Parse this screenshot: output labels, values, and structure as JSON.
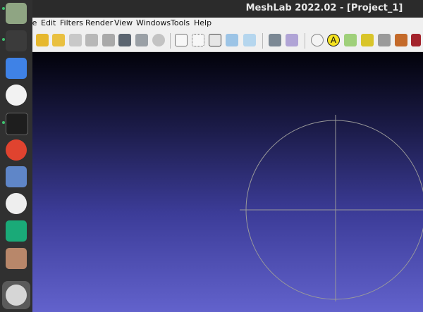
{
  "window": {
    "title": "MeshLab 2022.02 - [Project_1]"
  },
  "menu": {
    "file": "File",
    "edit": "Edit",
    "filters": "Filters",
    "render": "Render",
    "view": "View",
    "windows": "Windows",
    "tools": "Tools",
    "help": "Help"
  },
  "toolbar": {
    "icons": [
      "new-project-icon",
      "open-project-icon",
      "open-mesh-icon",
      "reload-icon",
      "reload-all-icon",
      "save-snapshot-icon",
      "camera-icon",
      "layer-stack-icon",
      "globe-render-icon",
      "bbox-icon",
      "points-icon",
      "wireframe-icon",
      "flat-shading-icon",
      "smooth-shading-icon",
      "layers-icon",
      "axes-icon",
      "trackball-icon",
      "text-annotation-icon",
      "move-axes-icon",
      "paint-bucket-icon",
      "capture-icon",
      "brush-icon",
      "color-picker-icon"
    ],
    "label_annotation": "A"
  },
  "dock": {
    "apps": [
      "files-icon",
      "system-monitor-icon",
      "text-editor-icon",
      "android-studio-icon",
      "terminal-icon",
      "chrome-icon",
      "calculator-icon",
      "inkscape-icon",
      "clion-icon",
      "image-viewer-icon",
      "meshlab-icon"
    ]
  },
  "colors": {
    "titlebar": "#2b2b2b",
    "menubar": "#f0f0f0",
    "dock": "#303030",
    "viewport_top": "#02020a",
    "viewport_bottom": "#6262cc",
    "trackball": "#9a9a9a"
  }
}
